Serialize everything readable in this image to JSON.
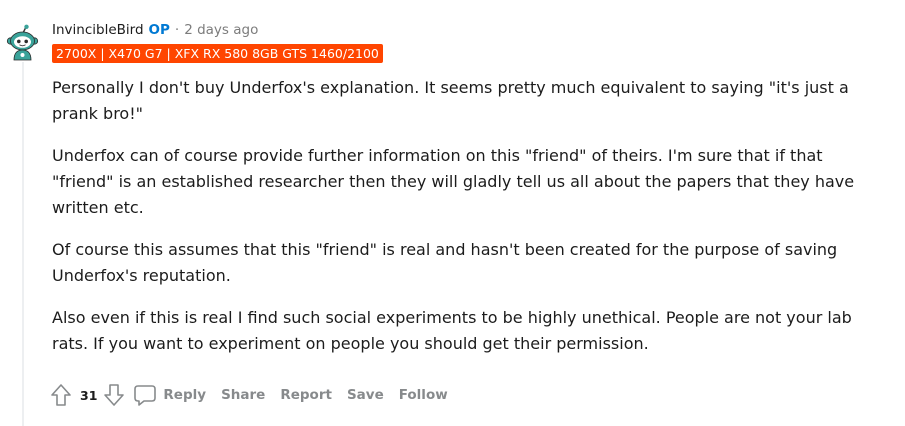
{
  "comment": {
    "username": "InvincibleBird",
    "op_tag": "OP",
    "separator": "·",
    "timestamp": "2 days ago",
    "flair": "2700X | X470 G7 | XFX RX 580 8GB GTS 1460/2100",
    "flair_color": "#ff4500",
    "avatar_icon": "snoo-avatar-icon",
    "paragraphs": [
      "Personally I don't buy Underfox's explanation. It seems pretty much equivalent to saying \"it's just a prank bro!\"",
      "Underfox can of course provide further information on this \"friend\" of theirs. I'm sure that if that \"friend\" is an established researcher then they will gladly tell us all about the papers that they have written etc.",
      "Of course this assumes that this \"friend\" is real and hasn't been created for the purpose of saving Underfox's reputation.",
      "Also even if this is real I find such social experiments to be highly unethical. People are not your lab rats. If you want to experiment on people you should get their permission."
    ]
  },
  "actions": {
    "upvote_icon": "upvote-arrow-icon",
    "score": "31",
    "downvote_icon": "downvote-arrow-icon",
    "reply_icon": "speech-bubble-icon",
    "reply": "Reply",
    "share": "Share",
    "report": "Report",
    "save": "Save",
    "follow": "Follow"
  },
  "colors": {
    "op_blue": "#0079d3",
    "meta_gray": "#7c7c7c",
    "action_gray": "#878a8c",
    "text": "#1c1c1c"
  }
}
